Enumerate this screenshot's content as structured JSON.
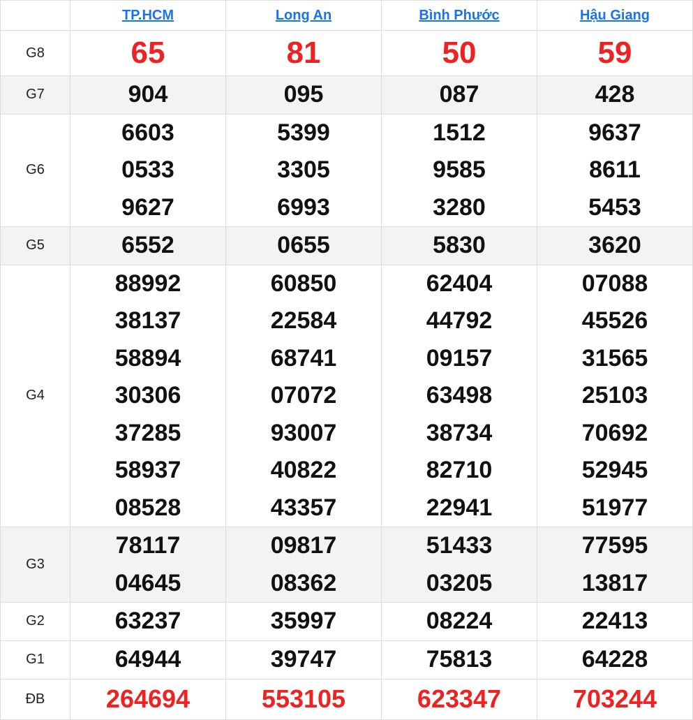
{
  "provinces": [
    "TP.HCM",
    "Long An",
    "Bình Phước",
    "Hậu Giang"
  ],
  "prizes": [
    {
      "label": "G8",
      "values": [
        [
          "65"
        ],
        [
          "81"
        ],
        [
          "50"
        ],
        [
          "59"
        ]
      ]
    },
    {
      "label": "G7",
      "values": [
        [
          "904"
        ],
        [
          "095"
        ],
        [
          "087"
        ],
        [
          "428"
        ]
      ]
    },
    {
      "label": "G6",
      "values": [
        [
          "6603",
          "0533",
          "9627"
        ],
        [
          "5399",
          "3305",
          "6993"
        ],
        [
          "1512",
          "9585",
          "3280"
        ],
        [
          "9637",
          "8611",
          "5453"
        ]
      ]
    },
    {
      "label": "G5",
      "values": [
        [
          "6552"
        ],
        [
          "0655"
        ],
        [
          "5830"
        ],
        [
          "3620"
        ]
      ]
    },
    {
      "label": "G4",
      "values": [
        [
          "88992",
          "38137",
          "58894",
          "30306",
          "37285",
          "58937",
          "08528"
        ],
        [
          "60850",
          "22584",
          "68741",
          "07072",
          "93007",
          "40822",
          "43357"
        ],
        [
          "62404",
          "44792",
          "09157",
          "63498",
          "38734",
          "82710",
          "22941"
        ],
        [
          "07088",
          "45526",
          "31565",
          "25103",
          "70692",
          "52945",
          "51977"
        ]
      ]
    },
    {
      "label": "G3",
      "values": [
        [
          "78117",
          "04645"
        ],
        [
          "09817",
          "08362"
        ],
        [
          "51433",
          "03205"
        ],
        [
          "77595",
          "13817"
        ]
      ]
    },
    {
      "label": "G2",
      "values": [
        [
          "63237"
        ],
        [
          "35997"
        ],
        [
          "08224"
        ],
        [
          "22413"
        ]
      ]
    },
    {
      "label": "G1",
      "values": [
        [
          "64944"
        ],
        [
          "39747"
        ],
        [
          "75813"
        ],
        [
          "64228"
        ]
      ]
    },
    {
      "label": "ĐB",
      "values": [
        [
          "264694"
        ],
        [
          "553105"
        ],
        [
          "623347"
        ],
        [
          "703244"
        ]
      ]
    }
  ],
  "colors": {
    "link": "#1a73e8",
    "highlight": "#ee2222",
    "shade": "#f3f3f3",
    "border": "#dddddd"
  }
}
